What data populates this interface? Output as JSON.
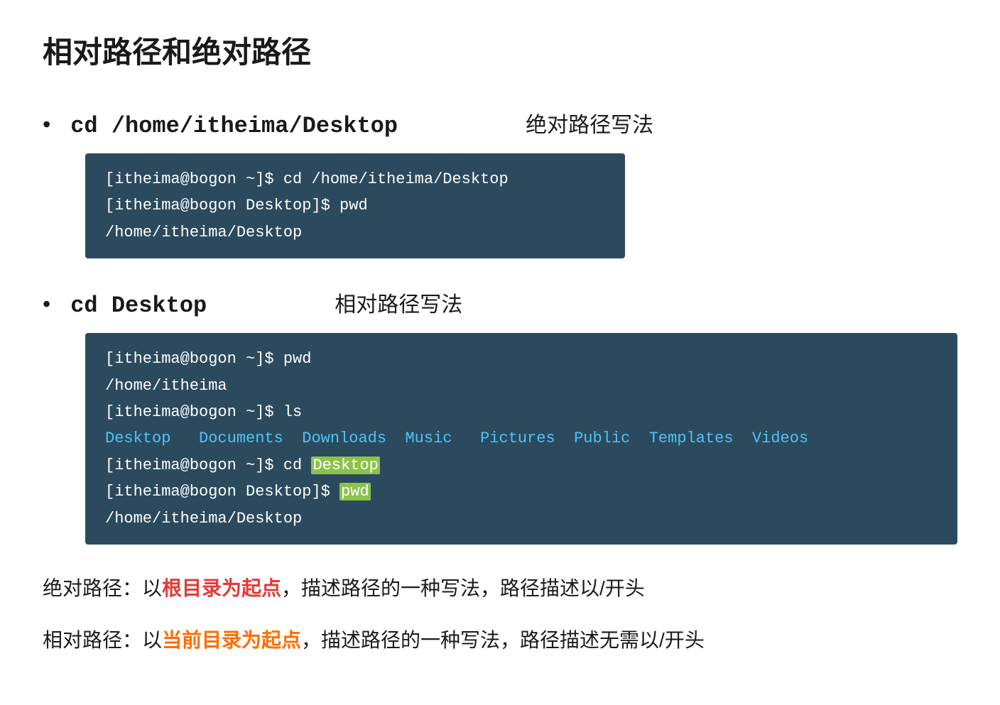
{
  "title": "相对路径和绝对路径",
  "section1": {
    "bullet": "•",
    "command": "cd /home/itheima/Desktop",
    "label": "绝对路径写法",
    "terminal": {
      "lines": [
        {
          "text": "[itheima@bogon ~]$ cd /home/itheima/Desktop",
          "type": "normal"
        },
        {
          "text": "[itheima@bogon Desktop]$ pwd",
          "type": "normal"
        },
        {
          "text": "/home/itheima/Desktop",
          "type": "normal"
        }
      ]
    }
  },
  "section2": {
    "bullet": "•",
    "command": "cd Desktop",
    "label": "相对路径写法",
    "terminal": {
      "lines": [
        {
          "text": "[itheima@bogon ~]$ pwd",
          "type": "normal"
        },
        {
          "text": "/home/itheima",
          "type": "normal"
        },
        {
          "text": "[itheima@bogon ~]$ ls",
          "type": "normal"
        },
        {
          "text": "Desktop   Documents  Downloads  Music   Pictures  Public  Templates  Videos",
          "type": "ls"
        },
        {
          "text": "[itheima@bogon ~]$ cd Desktop",
          "type": "normal-highlight-desktop"
        },
        {
          "text": "[itheima@bogon Desktop]$ pwd",
          "type": "normal-highlight-pwd"
        },
        {
          "text": "/home/itheima/Desktop",
          "type": "normal"
        }
      ]
    }
  },
  "explanations": [
    {
      "prefix": "绝对路径：以",
      "highlight": "根目录为起点",
      "suffix": "，描述路径的一种写法，路径描述以/开头",
      "color": "red"
    },
    {
      "prefix": "相对路径：以",
      "highlight": "当前目录为起点",
      "suffix": "，描述路径的一种写法，路径描述无需以/开头",
      "color": "orange"
    }
  ]
}
